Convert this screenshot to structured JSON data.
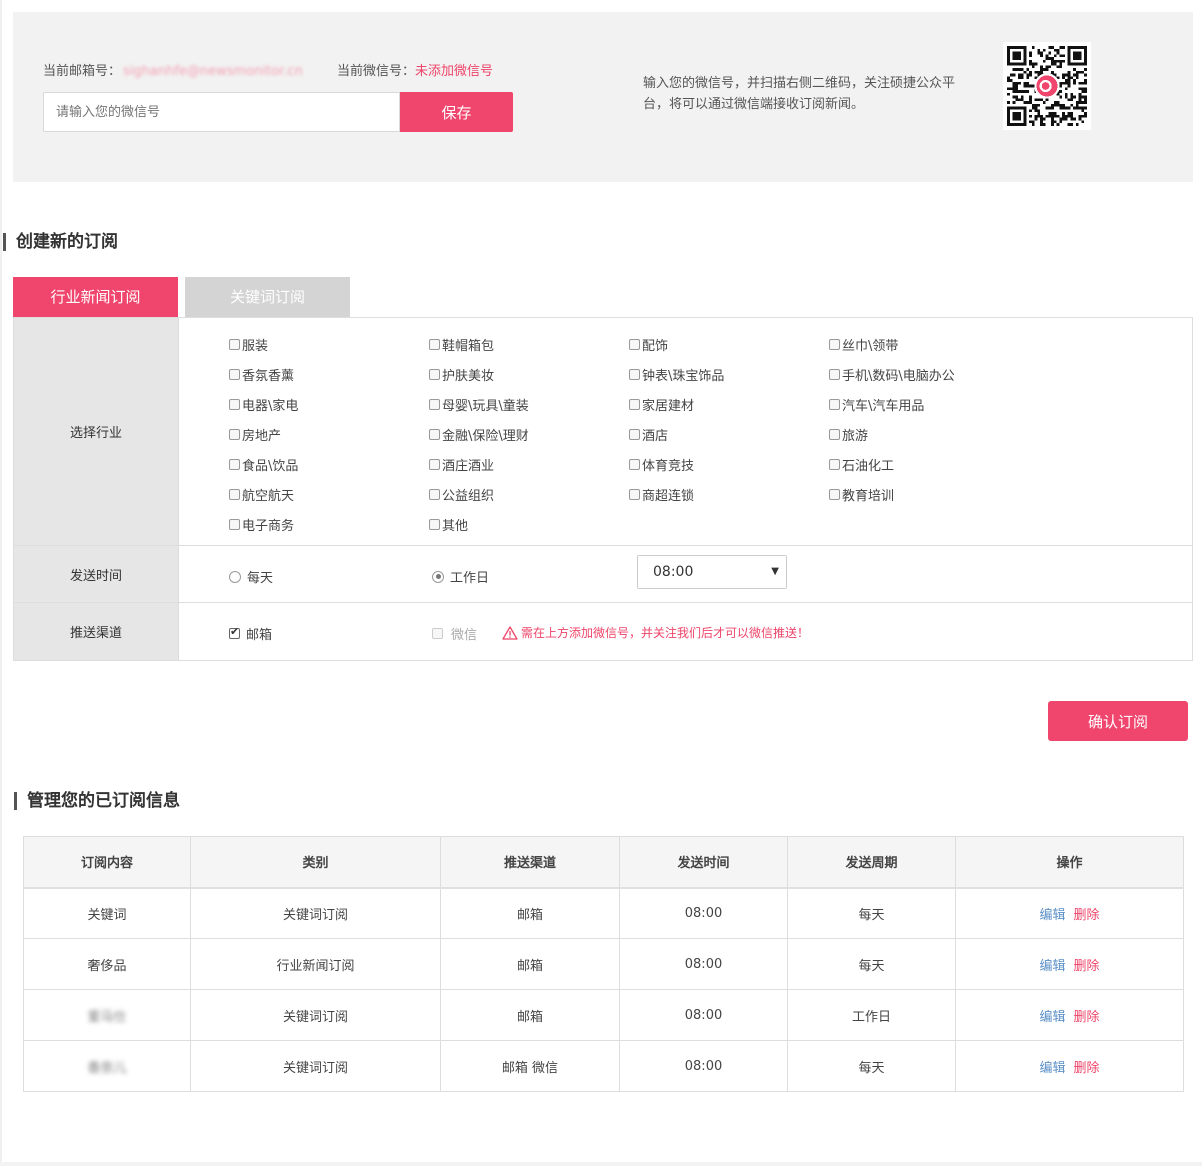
{
  "top": {
    "email_label": "当前邮箱号：",
    "email_value": "sighanhfe@newsmonitor.cn",
    "wechat_label": "当前微信号：",
    "wechat_value": "未添加微信号",
    "wechat_placeholder": "请输入您的微信号",
    "save_label": "保存",
    "tip": "输入您的微信号，并扫描右侧二维码，关注硕捷公众平台，将可以通过微信端接收订阅新闻。"
  },
  "create": {
    "title": "创建新的订阅",
    "tabs": [
      {
        "label": "行业新闻订阅",
        "active": true
      },
      {
        "label": "关键词订阅",
        "active": false
      }
    ],
    "industry_label": "选择行业",
    "industries": [
      "服装",
      "鞋帽箱包",
      "配饰",
      "丝巾\\领带",
      "香氛香薰",
      "护肤美妆",
      "钟表\\珠宝饰品",
      "手机\\数码\\电脑办公",
      "电器\\家电",
      "母婴\\玩具\\童装",
      "家居建材",
      "汽车\\汽车用品",
      "房地产",
      "金融\\保险\\理财",
      "酒店",
      "旅游",
      "食品\\饮品",
      "酒庄酒业",
      "体育竞技",
      "石油化工",
      "航空航天",
      "公益组织",
      "商超连锁",
      "教育培训",
      "电子商务",
      "其他"
    ],
    "time_label": "发送时间",
    "time_options": [
      "每天",
      "工作日"
    ],
    "time_selected_option": "工作日",
    "time_value": "08:00",
    "channel_label": "推送渠道",
    "channel_email": "邮箱",
    "channel_email_checked": true,
    "channel_wechat": "微信",
    "channel_wechat_checked": false,
    "warning": "需在上方添加微信号，并关注我们后才可以微信推送！",
    "confirm_label": "确认订阅"
  },
  "manage": {
    "title": "管理您的已订阅信息",
    "columns": [
      "订阅内容",
      "类别",
      "推送渠道",
      "发送时间",
      "发送周期",
      "操作"
    ],
    "rows": [
      {
        "content": "关键词",
        "category": "关键词订阅",
        "channel": "邮箱",
        "time": "08:00",
        "period": "每天",
        "edit": "编辑",
        "del": "删除",
        "blur": false
      },
      {
        "content": "奢侈品",
        "category": "行业新闻订阅",
        "channel": "邮箱",
        "time": "08:00",
        "period": "每天",
        "edit": "编辑",
        "del": "删除",
        "blur": false
      },
      {
        "content": "爱马仕",
        "category": "关键词订阅",
        "channel": "邮箱",
        "time": "08:00",
        "period": "工作日",
        "edit": "编辑",
        "del": "删除",
        "blur": true
      },
      {
        "content": "香奈儿",
        "category": "关键词订阅",
        "channel": "邮箱 微信",
        "time": "08:00",
        "period": "每天",
        "edit": "编辑",
        "del": "删除",
        "blur": true
      }
    ]
  },
  "colors": {
    "accent": "#f0456d",
    "tab_inactive": "#d4d4d4",
    "label_bg": "#e6e6e6",
    "edit_link": "#5a8fc7"
  }
}
